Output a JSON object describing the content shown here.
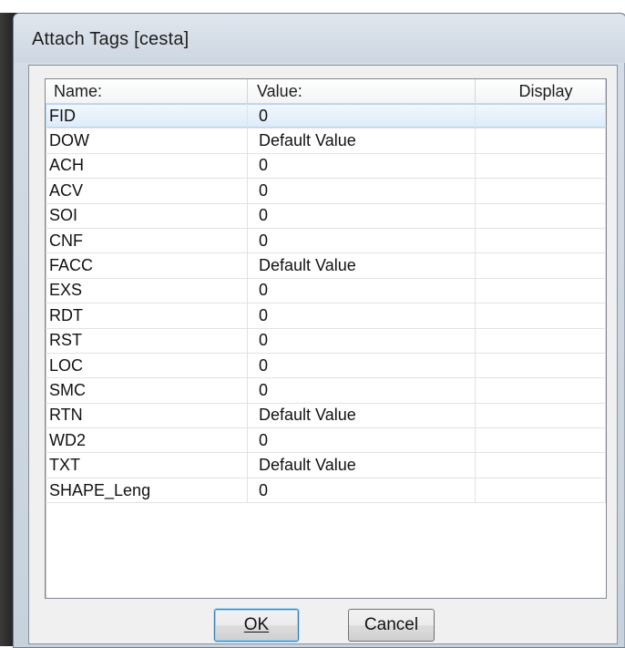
{
  "dialog": {
    "title": "Attach Tags [cesta]"
  },
  "table": {
    "columns": [
      "Name:",
      "Value:",
      "Display"
    ],
    "rows": [
      {
        "name": "FID",
        "value": "0",
        "display": "",
        "selected": true
      },
      {
        "name": "DOW",
        "value": "Default Value",
        "display": ""
      },
      {
        "name": "ACH",
        "value": "0",
        "display": ""
      },
      {
        "name": "ACV",
        "value": "0",
        "display": ""
      },
      {
        "name": "SOI",
        "value": "0",
        "display": ""
      },
      {
        "name": "CNF",
        "value": "0",
        "display": ""
      },
      {
        "name": "FACC",
        "value": "Default Value",
        "display": ""
      },
      {
        "name": "EXS",
        "value": "0",
        "display": ""
      },
      {
        "name": "RDT",
        "value": "0",
        "display": ""
      },
      {
        "name": "RST",
        "value": "0",
        "display": ""
      },
      {
        "name": "LOC",
        "value": "0",
        "display": ""
      },
      {
        "name": "SMC",
        "value": "0",
        "display": ""
      },
      {
        "name": "RTN",
        "value": "Default Value",
        "display": ""
      },
      {
        "name": "WD2",
        "value": "0",
        "display": ""
      },
      {
        "name": "TXT",
        "value": "Default Value",
        "display": ""
      },
      {
        "name": "SHAPE_Leng",
        "value": "0",
        "display": ""
      }
    ]
  },
  "buttons": {
    "ok_label": "OK",
    "cancel_label": "Cancel"
  }
}
